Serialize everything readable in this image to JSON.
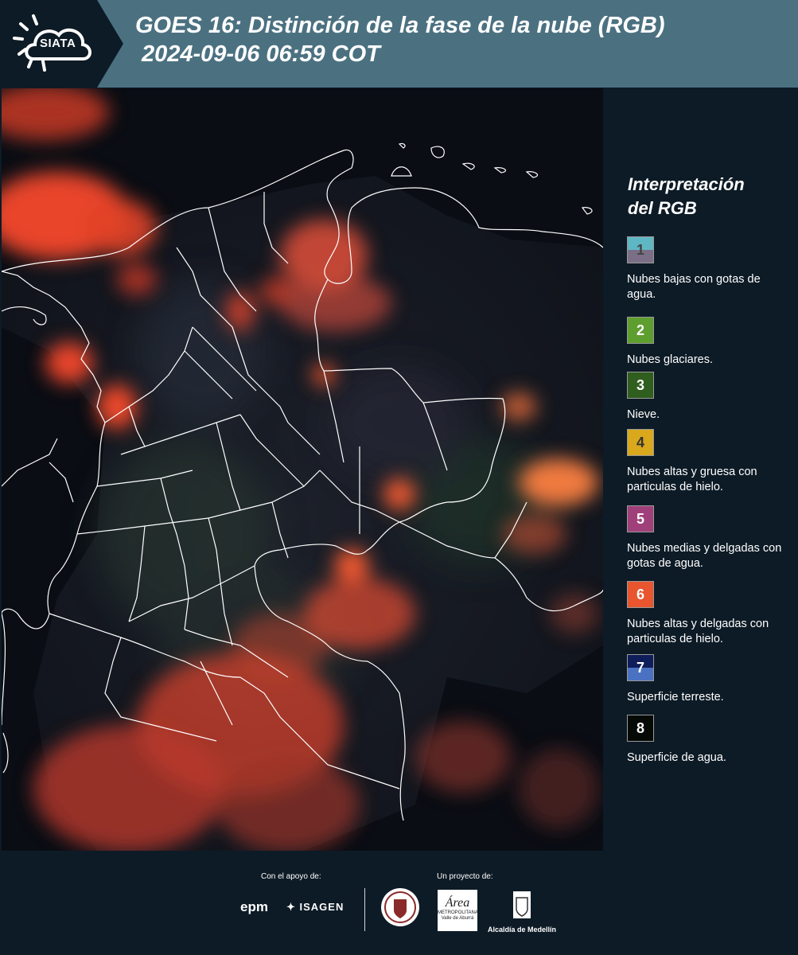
{
  "header": {
    "logo_text": "SIATA",
    "title_line1": "GOES 16: Distinción de la fase de la nube (RGB)",
    "title_line2": "2024-09-06 06:59 COT"
  },
  "legend": {
    "title_line1": "Interpretación",
    "title_line2": "del RGB",
    "items": [
      {
        "num": "1",
        "label": "Nubes bajas con gotas de agua.",
        "color_top": "#5fb7c4",
        "color_bottom": "#7a6f86",
        "num_color": "#444444"
      },
      {
        "num": "2",
        "label": "Nubes glaciares.",
        "color_top": "#5e9e2e",
        "color_bottom": "#5e9e2e",
        "num_color": "#ffffff"
      },
      {
        "num": "3",
        "label": "Nieve.",
        "color_top": "#2f5e1e",
        "color_bottom": "#2f5e1e",
        "num_color": "#ffffff"
      },
      {
        "num": "4",
        "label": "Nubes altas y gruesa con particulas de hielo.",
        "color_top": "#d9a81c",
        "color_bottom": "#d9a81c",
        "num_color": "#333333"
      },
      {
        "num": "5",
        "label": "Nubes medias y delgadas con gotas de agua.",
        "color_top": "#a0407a",
        "color_bottom": "#a0407a",
        "num_color": "#ffffff"
      },
      {
        "num": "6",
        "label": "Nubes altas y delgadas con particulas de hielo.",
        "color_top": "#e8552f",
        "color_bottom": "#e8552f",
        "num_color": "#ffffff"
      },
      {
        "num": "7",
        "label": "Superficie terreste.",
        "color_top": "#0f1e5a",
        "color_bottom": "#4b72c2",
        "num_color": "#ffffff"
      },
      {
        "num": "8",
        "label": "Superficie de agua.",
        "color_top": "#060a06",
        "color_bottom": "#060a06",
        "num_color": "#ffffff"
      }
    ]
  },
  "footer": {
    "support_label": "Con el apoyo de:",
    "epm": "epm",
    "isagen": "ISAGEN",
    "project_label": "Un proyecto de:",
    "area_name": "Área",
    "area_sub": "METROPOLITANA Valle de Aburrá",
    "alcaldia": "Alcaldía de Medellín"
  },
  "map": {
    "cloud_color": "#e8452a",
    "boundary_color": "#ffffff"
  }
}
